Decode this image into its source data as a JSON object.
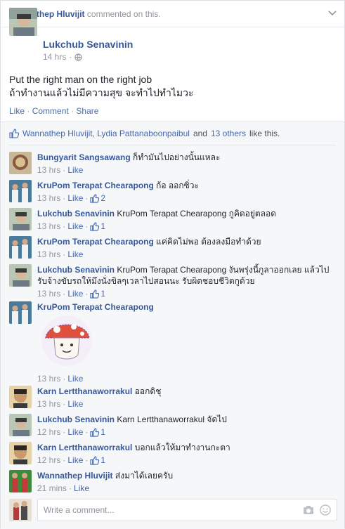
{
  "story": {
    "actor": "Wannathep Hluvijit",
    "action_text": "commented on this."
  },
  "post": {
    "author": "Lukchub Senavinin",
    "time": "14 hrs",
    "privacy_icon": "globe-icon",
    "line1": "Put the right man on the right job",
    "line2": "ถ้าทำงานแล้วไม่มีความสุข จะทำไปทำไมวะ",
    "actions": {
      "like": "Like",
      "comment": "Comment",
      "share": "Share"
    }
  },
  "likes": {
    "names": "Wannathep Hluvijit, Lydia Pattanaboonpaibul",
    "and": "and",
    "others": "13 others",
    "suffix": "like this."
  },
  "comments": [
    {
      "name": "Bungyarit Sangsawang",
      "text": "ก็ทำมันไปอย่างนั้นแหละ",
      "time": "13 hrs",
      "like": "Like",
      "likes": ""
    },
    {
      "name": "KruPom Terapat Chearapong",
      "text": "ก้อ ออกซิ่วะ",
      "time": "13 hrs",
      "like": "Like",
      "likes": "2"
    },
    {
      "name": "Lukchub Senavinin",
      "text": "KruPom Terapat Chearapong กูคิดอยู่ตลอด",
      "time": "13 hrs",
      "like": "Like",
      "likes": "1"
    },
    {
      "name": "KruPom Terapat Chearapong",
      "text": "แค่คิดไม่พอ ต้องลงมือทำด้วย",
      "time": "13 hrs",
      "like": "Like",
      "likes": ""
    },
    {
      "name": "Lukchub Senavinin",
      "text": "KruPom Terapat Chearapong งันพรุ่งนี้กูลาออกเลย แล้วไปรับจ้างขับรถให้มึงนั่งขิลๆเวลาไปสอนนะ รับผิดชอบชีวิตกูด้วย",
      "time": "13 hrs",
      "like": "Like",
      "likes": "1"
    },
    {
      "name": "KruPom Terapat Chearapong",
      "text": "",
      "time": "13 hrs",
      "like": "Like",
      "likes": ""
    },
    {
      "name": "Karn Lertthanaworrakul",
      "text": "ออกดิชุ",
      "time": "13 hrs",
      "like": "Like",
      "likes": ""
    },
    {
      "name": "Lukchub Senavinin",
      "text": "Karn Lertthanaworrakul จัดไป",
      "time": "12 hrs",
      "like": "Like",
      "likes": "1"
    },
    {
      "name": "Karn Lertthanaworrakul",
      "text": "บอกแล้วให้มาทำงานกะตา",
      "time": "12 hrs",
      "like": "Like",
      "likes": "1"
    },
    {
      "name": "Wannathep Hluvijit",
      "text": "ส่งมาได้เลยครับ",
      "time": "21 mins",
      "like": "Like",
      "likes": ""
    }
  ],
  "composer": {
    "placeholder": "Write a comment..."
  },
  "colors": {
    "link": "#365899",
    "meta": "#90949c",
    "ufi_bg": "#f6f7f9"
  }
}
